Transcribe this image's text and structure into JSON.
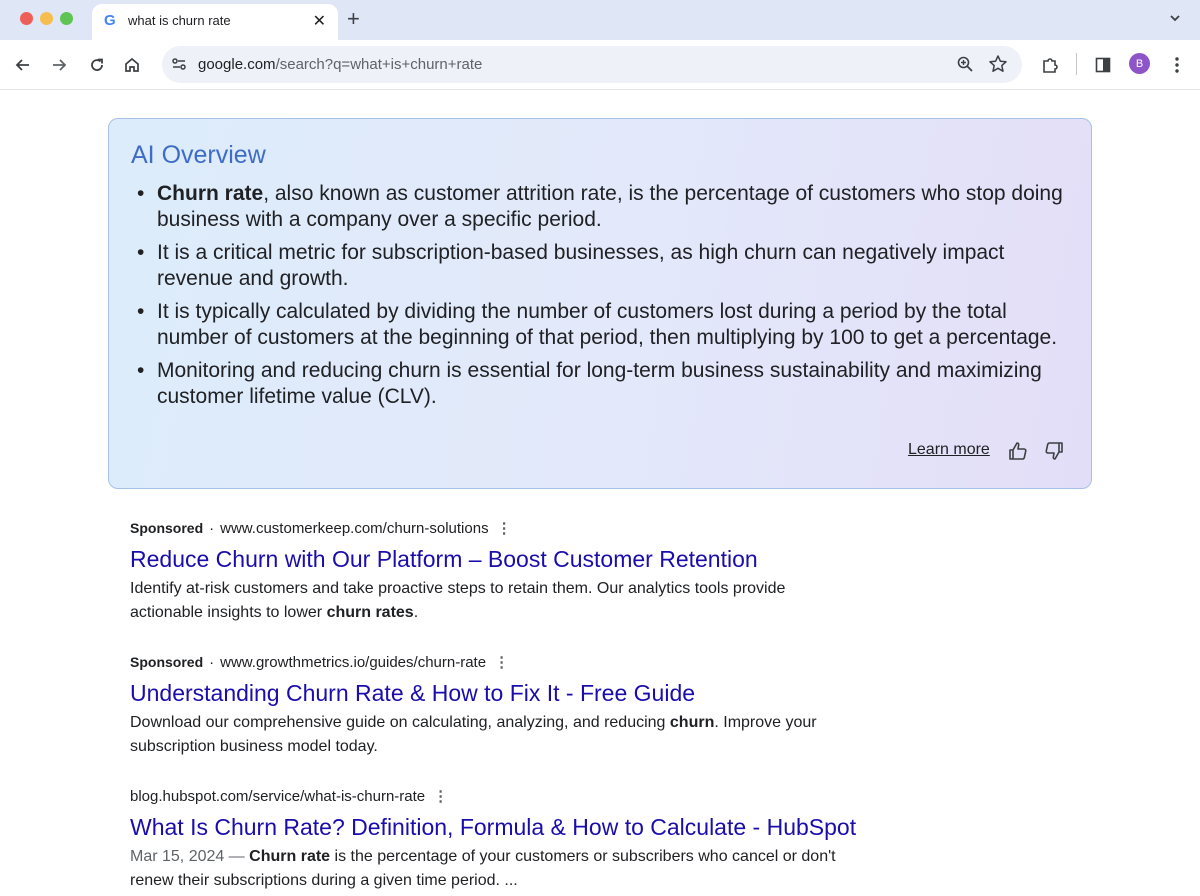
{
  "browser": {
    "tab_title": "what is churn rate",
    "tab_favicon": "G",
    "new_tab": "+",
    "close": "✕",
    "url_host": "google.com",
    "url_path": "/search?q=what+is+churn+rate",
    "avatar_initial": "B"
  },
  "ai_overview": {
    "title": "AI Overview",
    "bullets": [
      {
        "bold": "Churn rate",
        "text": ", also known as customer attrition rate, is the percentage of customers who stop doing business with a company over a specific period."
      },
      {
        "bold": "",
        "text": "It is a critical metric for subscription-based businesses, as high churn can negatively impact revenue and growth."
      },
      {
        "bold": "",
        "text": "It is typically calculated by dividing the number of customers lost during a period by the total number of customers at the beginning of that period, then multiplying by 100 to get a percentage."
      },
      {
        "bold": "",
        "text": "Monitoring and reducing churn is essential for long-term business sustainability and maximizing customer lifetime value (CLV)."
      }
    ],
    "learn_more": "Learn more"
  },
  "results": [
    {
      "sponsored": "Sponsored",
      "url": "www.customerkeep.com/churn-solutions",
      "title": "Reduce Churn with Our Platform – Boost Customer Retention",
      "desc_pre": "Identify at-risk customers and take proactive steps to retain them. Our analytics tools provide actionable insights to lower ",
      "desc_bold": "churn rates",
      "desc_post": "."
    },
    {
      "sponsored": "Sponsored",
      "url": "www.growthmetrics.io/guides/churn-rate",
      "title": "Understanding Churn Rate & How to Fix It - Free Guide",
      "desc_pre": "Download our comprehensive guide on calculating, analyzing, and reducing ",
      "desc_bold": "churn",
      "desc_post": ". Improve your subscription business model today."
    },
    {
      "url": "blog.hubspot.com/service/what-is-churn-rate",
      "title": "What Is Churn Rate? Definition, Formula & How to Calculate - HubSpot",
      "date": "Mar 15, 2024 — ",
      "desc_bold": "Churn rate",
      "desc_post": " is the percentage of your customers or subscribers who cancel or don't renew their subscriptions during a given time period. ..."
    }
  ],
  "icons": {
    "back": "arrow-left-icon",
    "forward": "arrow-right-icon",
    "reload": "reload-icon",
    "home": "home-icon",
    "zoom": "zoom-icon",
    "bookmark": "star-icon",
    "extensions": "puzzle-icon",
    "sidepanel": "side-panel-icon",
    "menu": "kebab-menu-icon"
  }
}
